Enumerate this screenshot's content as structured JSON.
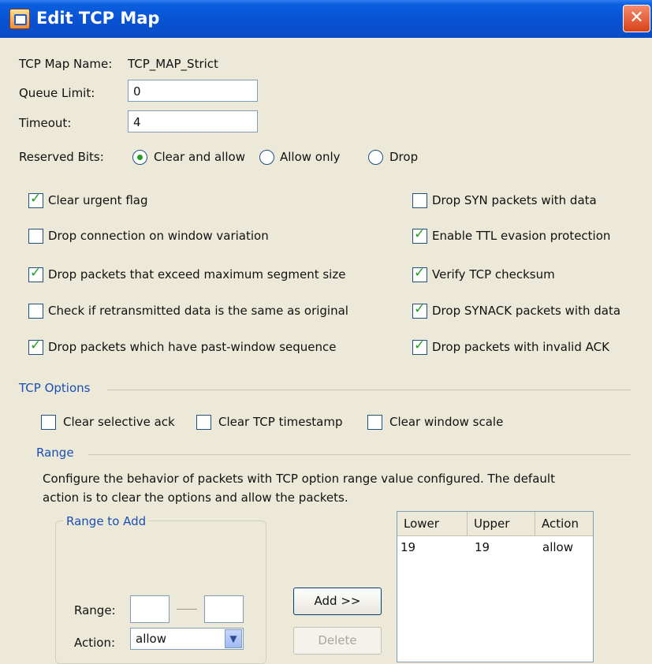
{
  "window": {
    "title": "Edit TCP Map",
    "close_glyph": "✕"
  },
  "map_name": {
    "label": "TCP Map Name:",
    "value": "TCP_MAP_Strict"
  },
  "queue_limit": {
    "label": "Queue Limit:",
    "value": "0"
  },
  "timeout": {
    "label": "Timeout:",
    "value": "4"
  },
  "reserved_bits": {
    "label": "Reserved Bits:",
    "options": [
      {
        "label": "Clear and allow",
        "selected": true
      },
      {
        "label": "Allow only",
        "selected": false
      },
      {
        "label": "Drop",
        "selected": false
      }
    ]
  },
  "checks_left": [
    {
      "label": "Clear urgent flag",
      "checked": true
    },
    {
      "label": "Drop connection on window variation",
      "checked": false
    },
    {
      "label": "Drop packets that exceed maximum segment size",
      "checked": true
    },
    {
      "label": "Check if retransmitted data is the same as original",
      "checked": false
    },
    {
      "label": "Drop packets which have past-window sequence",
      "checked": true
    }
  ],
  "checks_right": [
    {
      "label": "Drop SYN packets with data",
      "checked": false
    },
    {
      "label": "Enable TTL evasion protection",
      "checked": true
    },
    {
      "label": "Verify TCP checksum",
      "checked": true
    },
    {
      "label": "Drop SYNACK packets with data",
      "checked": true
    },
    {
      "label": "Drop packets with invalid ACK",
      "checked": true
    }
  ],
  "tcp_options": {
    "title": "TCP Options",
    "items": [
      {
        "label": "Clear selective ack",
        "checked": false
      },
      {
        "label": "Clear TCP timestamp",
        "checked": false
      },
      {
        "label": "Clear window scale",
        "checked": false
      }
    ]
  },
  "range": {
    "title": "Range",
    "description_line1": "Configure the behavior of packets with TCP option range value configured. The default",
    "description_line2": "action is to clear the options and allow the packets.",
    "range_to_add_title": "Range to Add",
    "range_label": "Range:",
    "range_from": "",
    "range_to": "",
    "action_label": "Action:",
    "action_value": "allow",
    "add_button": "Add >>",
    "delete_button": "Delete"
  },
  "table": {
    "columns": [
      "Lower",
      "Upper",
      "Action"
    ],
    "rows": [
      {
        "lower": "19",
        "upper": "19",
        "action": "allow"
      }
    ]
  },
  "colors": {
    "titlebar": "#0852d2",
    "section_title": "#1a4fb5",
    "check": "#21a121"
  }
}
